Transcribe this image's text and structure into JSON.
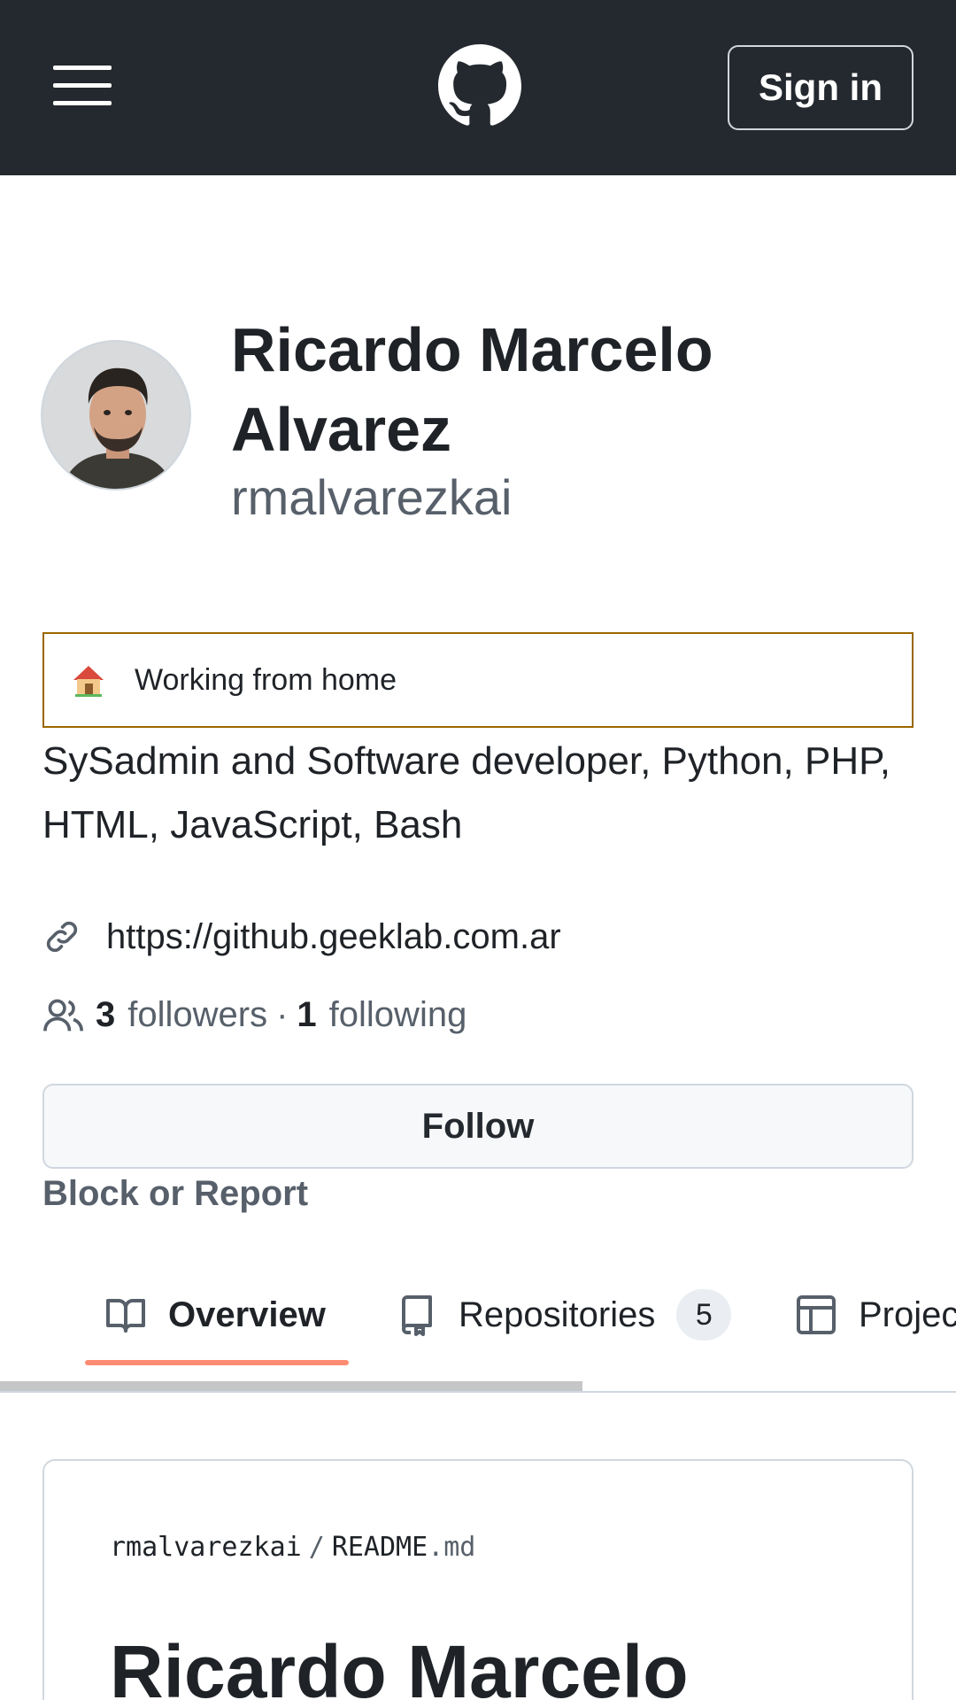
{
  "header": {
    "sign_in_label": "Sign in",
    "menu_icon": "hamburger-icon",
    "logo_icon": "github-logo"
  },
  "profile": {
    "name": "Ricardo Marcelo Alvarez",
    "login": "rmalvarezkai",
    "status": {
      "emoji_icon": "house-emoji",
      "text": "Working from home"
    },
    "bio": "SySadmin and Software developer, Python, PHP, HTML, JavaScript, Bash",
    "website": "https://github.geeklab.com.ar",
    "followers_count": "3",
    "followers_label": "followers",
    "separator": "·",
    "following_count": "1",
    "following_label": "following",
    "follow_label": "Follow",
    "block_label": "Block or Report"
  },
  "tabs": [
    {
      "label": "Overview",
      "icon": "book-icon",
      "selected": true
    },
    {
      "label": "Repositories",
      "icon": "repo-icon",
      "counter": "5"
    },
    {
      "label": "Projects",
      "icon": "table-icon"
    }
  ],
  "readme": {
    "owner": "rmalvarezkai",
    "slash": "/",
    "file_base": "README",
    "file_ext": ".md",
    "heading": "Ricardo Marcelo"
  },
  "colors": {
    "header_bg": "#24292f",
    "status_border": "#9a6700",
    "tab_underline": "#fd8c73",
    "muted_text": "#57606a"
  }
}
